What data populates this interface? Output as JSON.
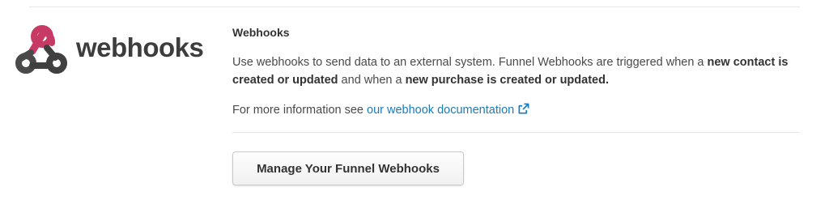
{
  "logo": {
    "text": "webhooks",
    "icon": "webhooks-logo-icon"
  },
  "section": {
    "heading": "Webhooks",
    "desc_part1": "Use webhooks to send data to an external system. Funnel Webhooks are triggered when a ",
    "desc_bold1": "new contact is created or updated",
    "desc_part2": " and when a ",
    "desc_bold2": "new purchase is created or updated.",
    "more_prefix": "For more information see ",
    "more_link": "our webhook documentation",
    "link_icon": "external-link-icon"
  },
  "button": {
    "manage_label": "Manage Your Funnel Webhooks"
  },
  "colors": {
    "link": "#1a7bbd",
    "logo_pink": "#c73a63",
    "logo_dark": "#4a4a4a",
    "logo_gray": "#404040"
  }
}
